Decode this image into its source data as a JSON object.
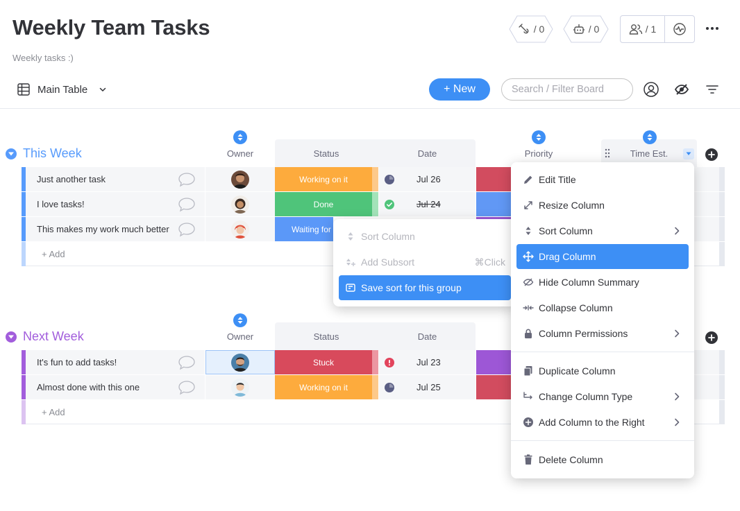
{
  "header": {
    "title": "Weekly Team Tasks",
    "subtitle": "Weekly tasks :)",
    "integrations_count": "/ 0",
    "automations_count": "/ 0",
    "members_count": "/ 1"
  },
  "toolbar": {
    "view_label": "Main Table",
    "new_label": "+ New",
    "search_placeholder": "Search / Filter Board"
  },
  "columns": {
    "owner": "Owner",
    "status": "Status",
    "date": "Date",
    "priority": "Priority",
    "time_est": "Time Est."
  },
  "groups": [
    {
      "title": "This Week",
      "color": "#579bfc",
      "add_label": "+ Add",
      "rows": [
        {
          "name": "Just another task",
          "status": "Working on it",
          "status_color": "#fdab3d",
          "date": "Jul 26",
          "date_done": false,
          "priority_color": "#e2445c"
        },
        {
          "name": "I love tasks!",
          "status": "Done",
          "status_color": "#00c875",
          "date": "Jul 24",
          "date_done": true,
          "priority_color": "#579bfc"
        },
        {
          "name": "This makes my work much better",
          "status": "Waiting for review",
          "status_color": "#579bfc",
          "date": "",
          "date_done": false,
          "priority_color": "#a25ddc"
        }
      ]
    },
    {
      "title": "Next Week",
      "color": "#a25ddc",
      "add_label": "+ Add",
      "rows": [
        {
          "name": "It's fun to add tasks!",
          "status": "Stuck",
          "status_color": "#e2445c",
          "date": "Jul 23",
          "date_done": false,
          "priority_color": "#a25ddc"
        },
        {
          "name": "Almost done with this one",
          "status": "Working on it",
          "status_color": "#fdab3d",
          "date": "Jul 25",
          "date_done": false,
          "priority_color": "#e2445c"
        }
      ]
    }
  ],
  "column_menu": {
    "items": [
      {
        "label": "Edit Title",
        "icon": "pencil-icon"
      },
      {
        "label": "Resize Column",
        "icon": "resize-icon"
      },
      {
        "label": "Sort Column",
        "icon": "sort-icon",
        "submenu": true
      },
      {
        "label": "Drag Column",
        "icon": "drag-icon",
        "active": true
      },
      {
        "label": "Hide Column Summary",
        "icon": "eye-hidden-icon"
      },
      {
        "label": "Collapse Column",
        "icon": "collapse-icon"
      },
      {
        "label": "Column Permissions",
        "icon": "lock-icon",
        "submenu": true
      },
      {
        "label": "Duplicate Column",
        "icon": "duplicate-icon"
      },
      {
        "label": "Change Column Type",
        "icon": "swap-icon",
        "submenu": true
      },
      {
        "label": "Add Column to the Right",
        "icon": "plus-circle-icon",
        "submenu": true
      },
      {
        "label": "Delete Column",
        "icon": "trash-icon"
      }
    ]
  },
  "sort_submenu": {
    "sort_column": "Sort Column",
    "add_subsort": "Add Subsort",
    "add_subsort_shortcut": "⌘Click",
    "save_sort": "Save sort for this group"
  },
  "colors": {
    "accent": "#3d8ff5",
    "working": "#fdab3d",
    "done": "#00c875",
    "stuck": "#e2445c",
    "waiting": "#579bfc"
  }
}
